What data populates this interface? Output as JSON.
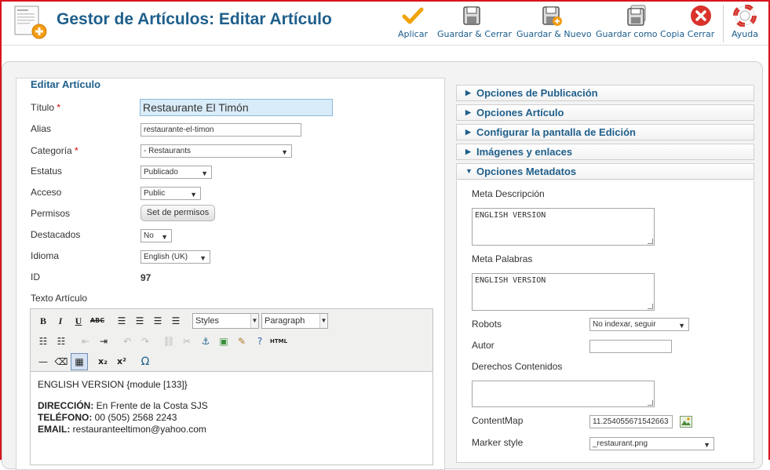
{
  "header": {
    "title": "Gestor de Artículos: Editar Artículo",
    "toolbar": {
      "apply": "Aplicar",
      "save_close": "Guardar & Cerrar",
      "save_new": "Guardar & Nuevo",
      "save_copy": "Guardar como Copia",
      "close": "Cerrar",
      "help": "Ayuda"
    }
  },
  "form": {
    "legend": "Editar Artículo",
    "title_label": "Título",
    "title_value": "Restaurante El Timón",
    "alias_label": "Alias",
    "alias_value": "restaurante-el-timon",
    "category_label": "Categoría",
    "category_value": "- Restaurants",
    "status_label": "Estatus",
    "status_value": "Publicado",
    "access_label": "Acceso",
    "access_value": "Public",
    "permissions_label": "Permisos",
    "permissions_button": "Set de permisos",
    "featured_label": "Destacados",
    "featured_value": "No",
    "language_label": "Idioma",
    "language_value": "English (UK)",
    "id_label": "ID",
    "id_value": "97",
    "text_label": "Texto Artículo",
    "required_mark": "*"
  },
  "editor": {
    "styles_value": "Styles",
    "format_value": "Paragraph",
    "content": {
      "line1": "ENGLISH VERSION {module [133]}",
      "address_label": "DIRECCIÓN:",
      "address_value": " En Frente de la Costa SJS",
      "phone_label": "TELÉFONO:",
      "phone_value": " 00 (505) 2568 2243",
      "email_label": "EMAIL:",
      "email_value": " restauranteeltimon@yahoo.com"
    }
  },
  "sidebar": {
    "panels": [
      {
        "label": "Opciones de Publicación",
        "state": "collapsed"
      },
      {
        "label": "Opciones Artículo",
        "state": "collapsed"
      },
      {
        "label": "Configurar la pantalla de Edición",
        "state": "collapsed"
      },
      {
        "label": "Imágenes y enlaces",
        "state": "collapsed"
      },
      {
        "label": "Opciones Metadatos",
        "state": "expanded"
      }
    ],
    "meta": {
      "description_label": "Meta Descripción",
      "description_value": "ENGLISH VERSION",
      "keywords_label": "Meta Palabras",
      "keywords_value": "ENGLISH VERSION",
      "robots_label": "Robots",
      "robots_value": "No indexar, seguir",
      "author_label": "Autor",
      "author_value": "",
      "rights_label": "Derechos Contenidos",
      "rights_value": "",
      "contentmap_label": "ContentMap",
      "contentmap_value": "11.254055671542663",
      "marker_label": "Marker style",
      "marker_value": "_restaurant.png"
    }
  },
  "colors": {
    "title_blue": "#1f5f8b",
    "apply_orange": "#f0a30a",
    "close_red": "#d9322b",
    "frame_red": "#d8141c"
  }
}
